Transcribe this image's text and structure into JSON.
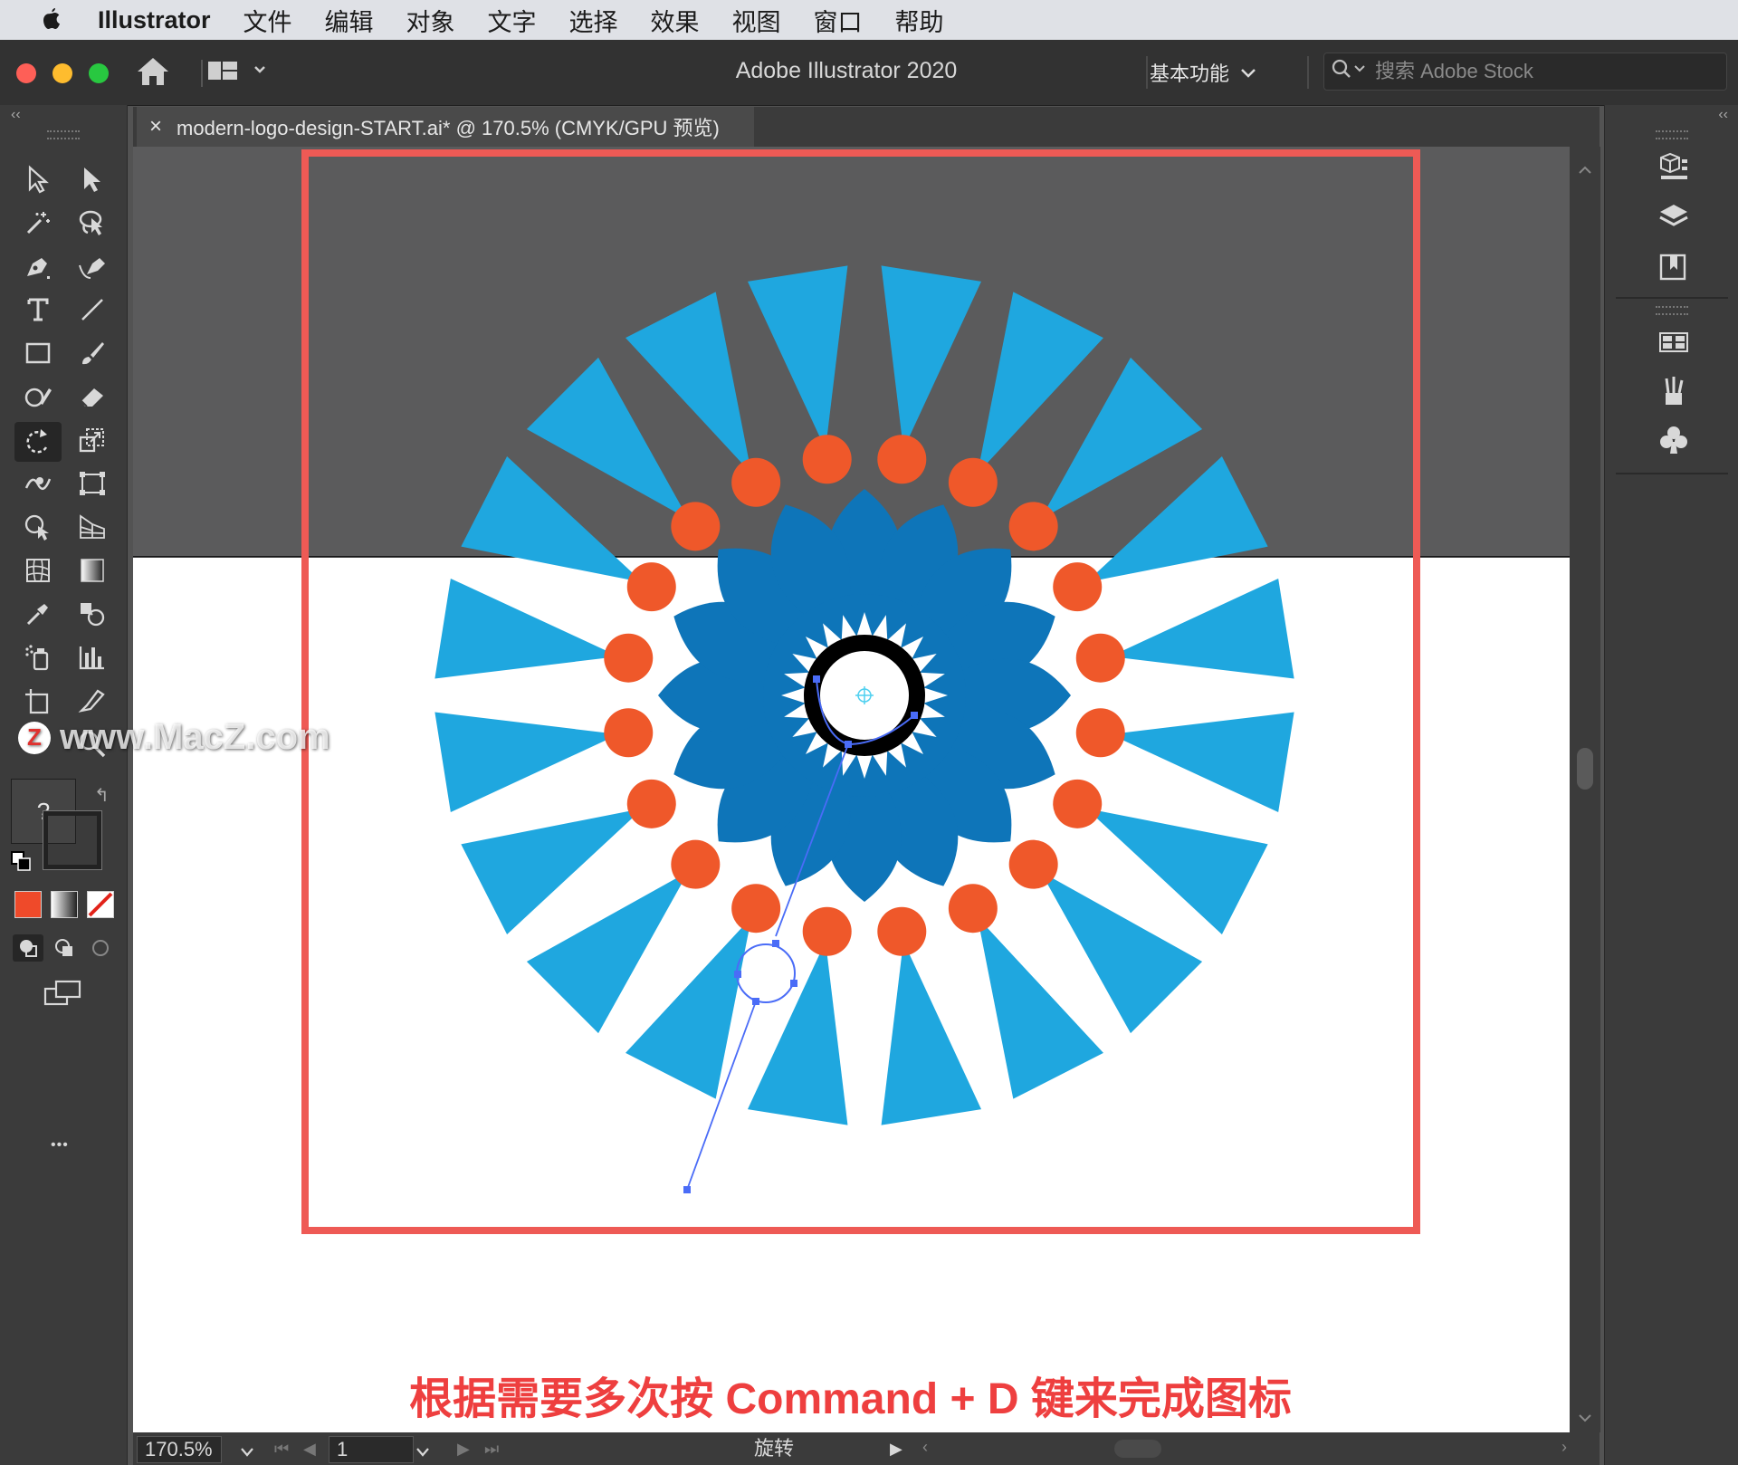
{
  "menubar": {
    "app_name": "Illustrator",
    "items": [
      "文件",
      "编辑",
      "对象",
      "文字",
      "选择",
      "效果",
      "视图",
      "窗口",
      "帮助"
    ]
  },
  "titlebar": {
    "title": "Adobe Illustrator 2020",
    "workspace": "基本功能",
    "search_placeholder": "搜索 Adobe Stock"
  },
  "document_tab": {
    "close": "×",
    "label": "modern-logo-design-START.ai* @ 170.5% (CMYK/GPU 预览)"
  },
  "toolbar": {
    "unknown_fill": "?",
    "more": "•••"
  },
  "statusbar": {
    "zoom": "170.5%",
    "artboard": "1",
    "tool_name": "旋转"
  },
  "overlay": {
    "caption": "根据需要多次按 Command + D 键来完成图标",
    "watermark": "www.MacZ.com",
    "watermark_logo": "Z"
  },
  "colors": {
    "light_blue": "#1fa7df",
    "dark_blue": "#0e75b9",
    "orange": "#ef582a",
    "highlight_red": "#ee5a55",
    "selection": "#4a6cf7"
  }
}
